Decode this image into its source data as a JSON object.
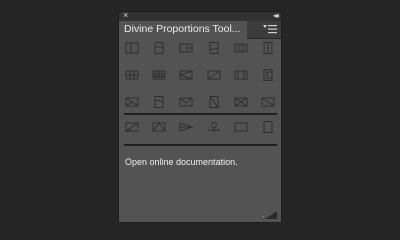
{
  "panel": {
    "title": "Divine Proportions Tool...",
    "close_symbol": "×",
    "collapse_symbol": "◂◂",
    "link_text": "Open online documentation.",
    "icons_row1": [
      "golden-ratio-vertical-icon",
      "golden-ratio-tall-icon",
      "golden-ratio-split-icon",
      "golden-ratio-portrait-icon",
      "golden-ratio-landscape-icon",
      "golden-ratio-right-icon"
    ],
    "icons_row2": [
      "grid-thirds-icon",
      "grid-fine-icon",
      "triangle-left-icon",
      "diagonal-split-icon",
      "column-split-icon",
      "rect-right-icon"
    ],
    "icons_row3": [
      "diagonal-x-icon",
      "spiral-portrait-icon",
      "envelope-icon",
      "diagonal-portrait-icon",
      "diagonal-x-wide-icon",
      "diagonal-landscape-icon"
    ],
    "icons_row4": [
      "triangle-right-icon",
      "triangle-up-icon",
      "triangle-fan-icon",
      "compass-icon",
      "rectangle-icon",
      "portrait-rect-icon"
    ]
  },
  "colors": {
    "background": "#262626",
    "panel": "#535353",
    "icon_stroke": "#2f2f2f"
  }
}
